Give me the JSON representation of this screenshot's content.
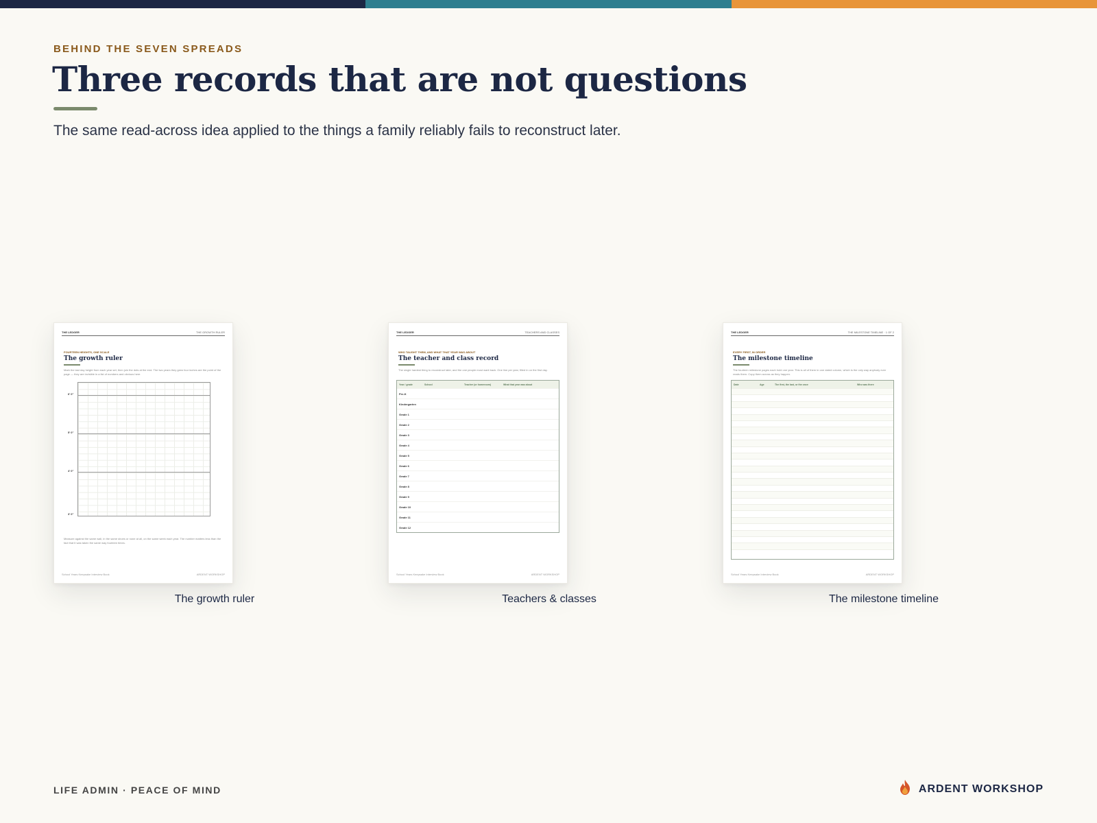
{
  "colors": {
    "navy": "#1c2744",
    "teal": "#2f7f8f",
    "orange": "#e8953a",
    "ochre": "#8a5a1c",
    "sage": "#7a8a6c"
  },
  "header": {
    "eyebrow": "BEHIND THE SEVEN SPREADS",
    "title": "Three records that are not questions",
    "subtitle": "The same read-across idea applied to the things a family reliably fails to reconstruct later."
  },
  "cards": [
    {
      "caption": "The growth ruler",
      "page": {
        "head_left": "THE LEDGER",
        "head_right": "THE GROWTH RULER",
        "eyebrow": "FOURTEEN HEIGHTS, ONE SCALE",
        "title": "The growth ruler",
        "intro": "Mark the last day height from each year set, then join the dots at the end. The two years they grew four inches are the point of the page — they are invisible in a list of numbers and obvious here.",
        "note": "Measure against the same wall, in the same shoes or none at all, on the same week each year. The number matters less than the fact that it was taken the same way fourteen times.",
        "foot_left": "School Years Keepsake Interview Book",
        "foot_right": "ARDENT WORKSHOP",
        "feet_labels": [
          "6' 0\"",
          "5' 0\"",
          "4' 0\"",
          "3' 0\""
        ]
      }
    },
    {
      "caption": "Teachers & classes",
      "page": {
        "head_left": "THE LEDGER",
        "head_right": "TEACHERS AND CLASSES",
        "eyebrow": "WHO TAUGHT THEM, AND WHAT THAT YEAR WAS ABOUT",
        "title": "The teacher and class record",
        "intro": "The single hardest thing to reconstruct later, and the one people most want back. One line per year, filled in on the first day.",
        "columns": [
          "Year / grade",
          "School",
          "Teacher (or homeroom)",
          "What that year was about"
        ],
        "rows": [
          "Pre-K",
          "Kindergarten",
          "Grade 1",
          "Grade 2",
          "Grade 3",
          "Grade 4",
          "Grade 5",
          "Grade 6",
          "Grade 7",
          "Grade 8",
          "Grade 9",
          "Grade 10",
          "Grade 11",
          "Grade 12"
        ],
        "foot_left": "School Years Keepsake Interview Book",
        "foot_right": "ARDENT WORKSHOP"
      }
    },
    {
      "caption": "The milestone timeline",
      "page": {
        "head_left": "THE LEDGER",
        "head_right": "THE MILESTONE TIMELINE · 1 OF 2",
        "eyebrow": "EVERY FIRST, IN ORDER",
        "title": "The milestone timeline",
        "intro": "The fourteen milestone pages each hold one year. This is all of them in one dated column, which is the only way anybody ever reads them. Copy them across as they happen.",
        "columns": [
          "Date",
          "Age",
          "The first, the last, or the once",
          "Who was there"
        ],
        "foot_left": "School Years Keepsake Interview Book",
        "foot_right": "ARDENT WORKSHOP"
      }
    }
  ],
  "footer": {
    "left": "LIFE ADMIN · PEACE OF MIND",
    "brand": "ARDENT WORKSHOP"
  }
}
